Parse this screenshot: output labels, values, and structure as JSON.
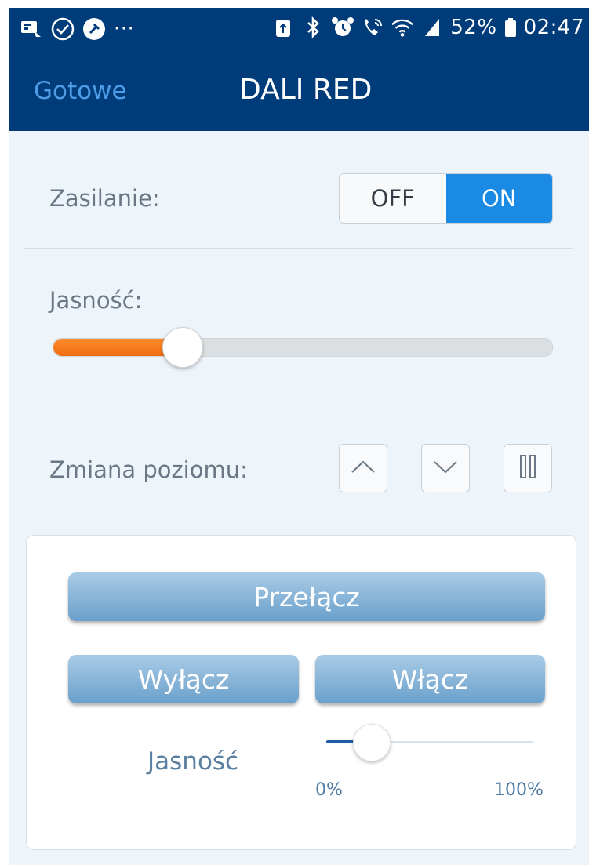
{
  "statusbar": {
    "left_icons": [
      "screen-cast-icon",
      "check-circle-icon",
      "pin-icon",
      "more-dots-icon"
    ],
    "more_dots": "···",
    "right_icons": [
      "battery-saver-icon",
      "bluetooth-icon",
      "alarm-icon",
      "wifi-call-icon",
      "wifi-icon",
      "signal-icon",
      "battery-icon"
    ],
    "battery_percent": "52%",
    "time": "02:47"
  },
  "header": {
    "back_label": "Gotowe",
    "title": "DALI RED"
  },
  "power": {
    "label": "Zasilanie:",
    "off_label": "OFF",
    "on_label": "ON",
    "active": "ON"
  },
  "brightness": {
    "label": "Jasność:",
    "level_fraction": 0.26
  },
  "level_change": {
    "label": "Zmiana poziomu:",
    "buttons": [
      "chevron-up-icon",
      "chevron-down-icon",
      "pause-icon"
    ]
  },
  "panel": {
    "toggle_label": "Przełącz",
    "off_label": "Wyłącz",
    "on_label": "Włącz",
    "brightness_label": "Jasność",
    "min_label": "0%",
    "max_label": "100%",
    "level_fraction": 0.15
  },
  "colors": {
    "header_bg": "#003c7a",
    "accent_blue": "#1b8ae4",
    "slider_orange": "#f47a1f",
    "page_bg": "#edf4fa"
  }
}
